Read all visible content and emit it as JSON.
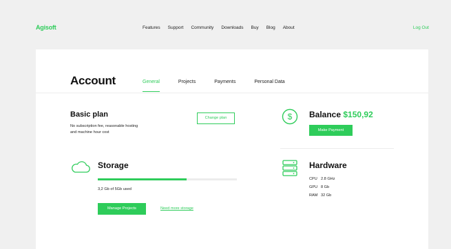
{
  "brand": {
    "logo": "Agisoft",
    "accent": "#2ecc5a"
  },
  "nav": {
    "items": [
      "Features",
      "Support",
      "Community",
      "Downloads",
      "Buy",
      "Blog",
      "About"
    ],
    "logout": "Log Out"
  },
  "page": {
    "title": "Account",
    "tabs": [
      {
        "label": "General",
        "active": true
      },
      {
        "label": "Projects",
        "active": false
      },
      {
        "label": "Payments",
        "active": false
      },
      {
        "label": "Personal Data",
        "active": false
      }
    ]
  },
  "plan": {
    "title": "Basic plan",
    "description_line1": "No subscription fee, reasonable hosting",
    "description_line2": "and machine hour cost",
    "change_button": "Change plan"
  },
  "balance": {
    "label": "Balance",
    "amount": "$150,92",
    "button": "Make Payment",
    "icon": "dollar-circle-icon"
  },
  "storage": {
    "title": "Storage",
    "used_text": "3,2 Gb of 5Gb used",
    "used_fraction": 0.64,
    "manage_button": "Manage Projects",
    "more_link": "Need more storage",
    "icon": "cloud-icon"
  },
  "hardware": {
    "title": "Hardware",
    "icon": "server-icon",
    "rows": [
      {
        "key": "CPU",
        "value": "2.8 GHz"
      },
      {
        "key": "GPU",
        "value": "8 Gb"
      },
      {
        "key": "RAM",
        "value": "32 Gb"
      }
    ]
  }
}
